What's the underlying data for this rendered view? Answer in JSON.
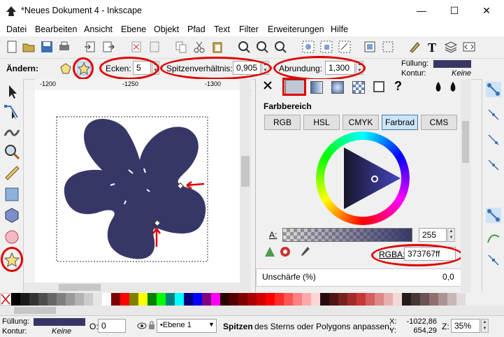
{
  "window": {
    "title": "*Neues Dokument 4 - Inkscape",
    "minimize_glyph": "—",
    "maximize_glyph": "☐",
    "close_glyph": "✕"
  },
  "menu": [
    "Datei",
    "Bearbeiten",
    "Ansicht",
    "Ebene",
    "Objekt",
    "Pfad",
    "Text",
    "Filter",
    "Erweiterungen",
    "Hilfe"
  ],
  "tool_controls": {
    "label": "Ändern:",
    "corners_label": "Ecken:",
    "corners_value": "5",
    "spoke_ratio_label": "Spitzenverhältnis:",
    "spoke_ratio_value": "0,905",
    "rounding_label": "Abrundung:",
    "rounding_value": "1,300",
    "fill_label": "Füllung:",
    "stroke_label": "Kontur:",
    "stroke_value": "Keine"
  },
  "ruler": {
    "labels": [
      "-1200",
      "-1250",
      "-1300"
    ]
  },
  "fill_panel": {
    "heading": "Farbbereich",
    "modes": [
      "RGB",
      "HSL",
      "CMYK",
      "Farbrad",
      "CMS"
    ],
    "active_mode": "Farbrad",
    "alpha_label": "A:",
    "alpha_value": "255",
    "rgba_label": "RGBA:",
    "rgba_value": "373767ff",
    "blur_label": "Unschärfe (%)",
    "blur_value": "0,0"
  },
  "colors": {
    "fill": "#373767",
    "accent": "#e00000"
  },
  "status": {
    "fill_label": "Füllung:",
    "stroke_label": "Kontur:",
    "stroke_value": "Keine",
    "opacity_label": "O:",
    "opacity_value": "0",
    "layer_value": "•Ebene 1",
    "message_bold": "Spitzen",
    "message_rest": " des Sterns oder Polygons anpassen;",
    "x_label": "X:",
    "x_value": "-1022,86",
    "y_label": "Y:",
    "y_value": "654,29",
    "zoom_label": "Z:",
    "zoom_value": "35%"
  }
}
